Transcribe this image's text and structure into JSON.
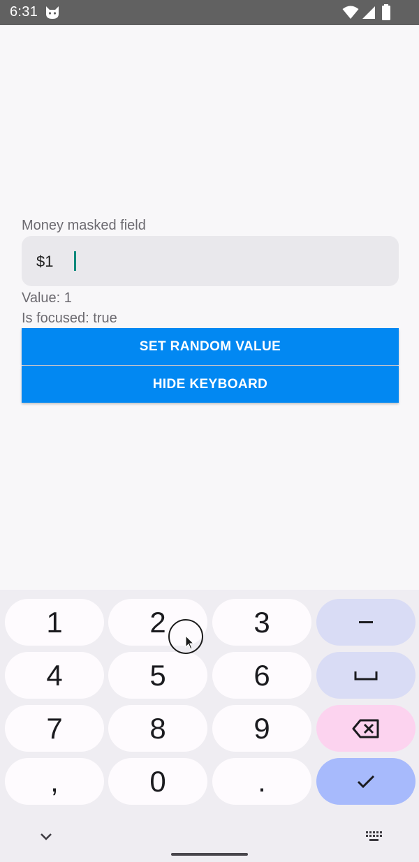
{
  "status_bar": {
    "time": "6:31",
    "icons": [
      "cat-icon",
      "wifi-icon",
      "signal-icon",
      "battery-icon"
    ]
  },
  "form": {
    "field_label": "Money masked field",
    "input_value": "$1",
    "value_text": "Value: 1",
    "focused_text": "Is focused: true",
    "set_random_label": "SET RANDOM VALUE",
    "hide_keyboard_label": "HIDE KEYBOARD"
  },
  "keyboard": {
    "rows": [
      [
        "1",
        "2",
        "3",
        "–"
      ],
      [
        "4",
        "5",
        "6",
        "␣"
      ],
      [
        "7",
        "8",
        "9",
        "⌫"
      ],
      [
        ",",
        "0",
        ".",
        "✓"
      ]
    ],
    "collapse_icon": "chevron-down-icon",
    "switch_icon": "keyboard-icon"
  },
  "colors": {
    "accent": "#0288f2",
    "caret": "#00897b",
    "delete_key": "#fcd3ef",
    "enter_key": "#a7bafc",
    "function_key": "#d9dcf5"
  }
}
